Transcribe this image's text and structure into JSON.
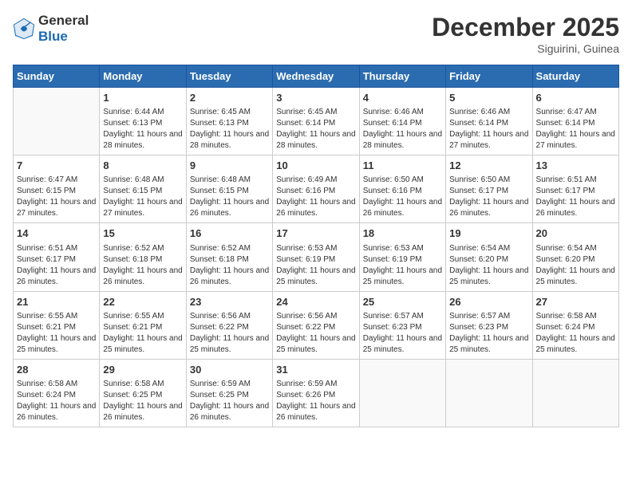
{
  "logo": {
    "line1": "General",
    "line2": "Blue"
  },
  "title": "December 2025",
  "subtitle": "Siguirini, Guinea",
  "days_header": [
    "Sunday",
    "Monday",
    "Tuesday",
    "Wednesday",
    "Thursday",
    "Friday",
    "Saturday"
  ],
  "weeks": [
    [
      {
        "day": "",
        "text": ""
      },
      {
        "day": "1",
        "text": "Sunrise: 6:44 AM\nSunset: 6:13 PM\nDaylight: 11 hours and 28 minutes."
      },
      {
        "day": "2",
        "text": "Sunrise: 6:45 AM\nSunset: 6:13 PM\nDaylight: 11 hours and 28 minutes."
      },
      {
        "day": "3",
        "text": "Sunrise: 6:45 AM\nSunset: 6:14 PM\nDaylight: 11 hours and 28 minutes."
      },
      {
        "day": "4",
        "text": "Sunrise: 6:46 AM\nSunset: 6:14 PM\nDaylight: 11 hours and 28 minutes."
      },
      {
        "day": "5",
        "text": "Sunrise: 6:46 AM\nSunset: 6:14 PM\nDaylight: 11 hours and 27 minutes."
      },
      {
        "day": "6",
        "text": "Sunrise: 6:47 AM\nSunset: 6:14 PM\nDaylight: 11 hours and 27 minutes."
      }
    ],
    [
      {
        "day": "7",
        "text": "Sunrise: 6:47 AM\nSunset: 6:15 PM\nDaylight: 11 hours and 27 minutes."
      },
      {
        "day": "8",
        "text": "Sunrise: 6:48 AM\nSunset: 6:15 PM\nDaylight: 11 hours and 27 minutes."
      },
      {
        "day": "9",
        "text": "Sunrise: 6:48 AM\nSunset: 6:15 PM\nDaylight: 11 hours and 26 minutes."
      },
      {
        "day": "10",
        "text": "Sunrise: 6:49 AM\nSunset: 6:16 PM\nDaylight: 11 hours and 26 minutes."
      },
      {
        "day": "11",
        "text": "Sunrise: 6:50 AM\nSunset: 6:16 PM\nDaylight: 11 hours and 26 minutes."
      },
      {
        "day": "12",
        "text": "Sunrise: 6:50 AM\nSunset: 6:17 PM\nDaylight: 11 hours and 26 minutes."
      },
      {
        "day": "13",
        "text": "Sunrise: 6:51 AM\nSunset: 6:17 PM\nDaylight: 11 hours and 26 minutes."
      }
    ],
    [
      {
        "day": "14",
        "text": "Sunrise: 6:51 AM\nSunset: 6:17 PM\nDaylight: 11 hours and 26 minutes."
      },
      {
        "day": "15",
        "text": "Sunrise: 6:52 AM\nSunset: 6:18 PM\nDaylight: 11 hours and 26 minutes."
      },
      {
        "day": "16",
        "text": "Sunrise: 6:52 AM\nSunset: 6:18 PM\nDaylight: 11 hours and 26 minutes."
      },
      {
        "day": "17",
        "text": "Sunrise: 6:53 AM\nSunset: 6:19 PM\nDaylight: 11 hours and 25 minutes."
      },
      {
        "day": "18",
        "text": "Sunrise: 6:53 AM\nSunset: 6:19 PM\nDaylight: 11 hours and 25 minutes."
      },
      {
        "day": "19",
        "text": "Sunrise: 6:54 AM\nSunset: 6:20 PM\nDaylight: 11 hours and 25 minutes."
      },
      {
        "day": "20",
        "text": "Sunrise: 6:54 AM\nSunset: 6:20 PM\nDaylight: 11 hours and 25 minutes."
      }
    ],
    [
      {
        "day": "21",
        "text": "Sunrise: 6:55 AM\nSunset: 6:21 PM\nDaylight: 11 hours and 25 minutes."
      },
      {
        "day": "22",
        "text": "Sunrise: 6:55 AM\nSunset: 6:21 PM\nDaylight: 11 hours and 25 minutes."
      },
      {
        "day": "23",
        "text": "Sunrise: 6:56 AM\nSunset: 6:22 PM\nDaylight: 11 hours and 25 minutes."
      },
      {
        "day": "24",
        "text": "Sunrise: 6:56 AM\nSunset: 6:22 PM\nDaylight: 11 hours and 25 minutes."
      },
      {
        "day": "25",
        "text": "Sunrise: 6:57 AM\nSunset: 6:23 PM\nDaylight: 11 hours and 25 minutes."
      },
      {
        "day": "26",
        "text": "Sunrise: 6:57 AM\nSunset: 6:23 PM\nDaylight: 11 hours and 25 minutes."
      },
      {
        "day": "27",
        "text": "Sunrise: 6:58 AM\nSunset: 6:24 PM\nDaylight: 11 hours and 25 minutes."
      }
    ],
    [
      {
        "day": "28",
        "text": "Sunrise: 6:58 AM\nSunset: 6:24 PM\nDaylight: 11 hours and 26 minutes."
      },
      {
        "day": "29",
        "text": "Sunrise: 6:58 AM\nSunset: 6:25 PM\nDaylight: 11 hours and 26 minutes."
      },
      {
        "day": "30",
        "text": "Sunrise: 6:59 AM\nSunset: 6:25 PM\nDaylight: 11 hours and 26 minutes."
      },
      {
        "day": "31",
        "text": "Sunrise: 6:59 AM\nSunset: 6:26 PM\nDaylight: 11 hours and 26 minutes."
      },
      {
        "day": "",
        "text": ""
      },
      {
        "day": "",
        "text": ""
      },
      {
        "day": "",
        "text": ""
      }
    ]
  ]
}
